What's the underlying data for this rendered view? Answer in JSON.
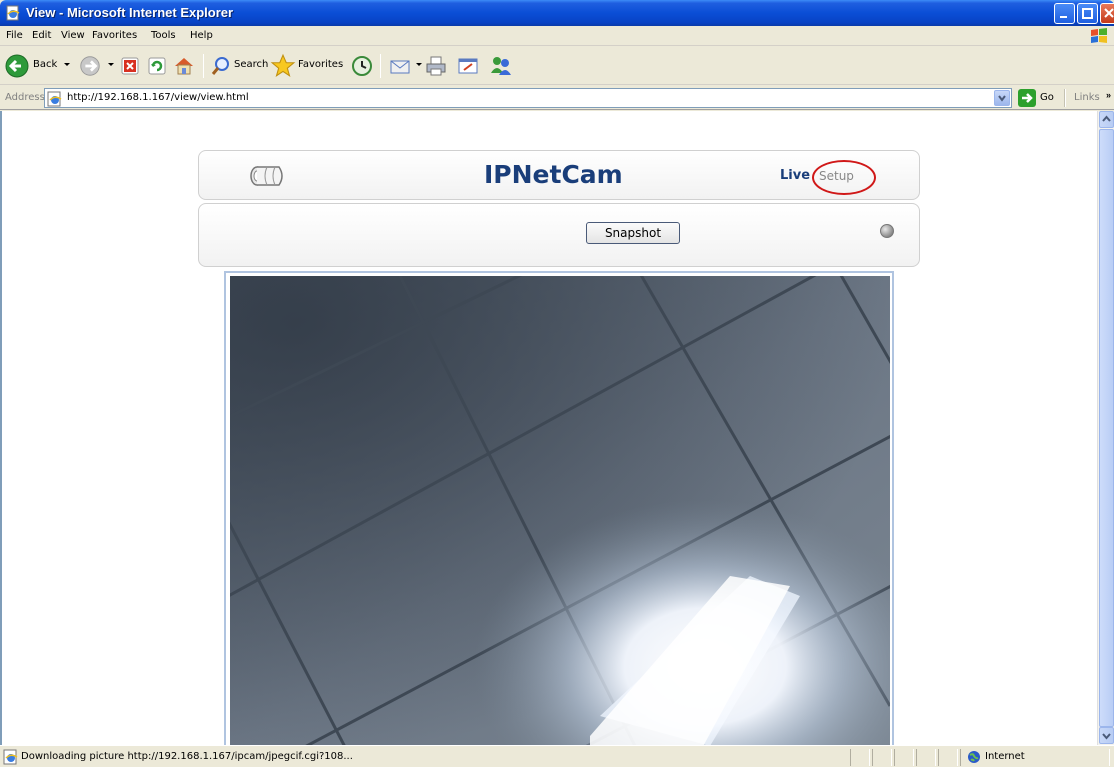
{
  "window": {
    "title": "View - Microsoft Internet Explorer"
  },
  "menu": {
    "items": [
      "File",
      "Edit",
      "View",
      "Favorites",
      "Tools",
      "Help"
    ]
  },
  "toolbar": {
    "back_label": "Back",
    "search_label": "Search",
    "favorites_label": "Favorites"
  },
  "address": {
    "label": "Address",
    "url": "http://192.168.1.167/view/view.html",
    "go_label": "Go",
    "links_label": "Links"
  },
  "page": {
    "brand": "IPNetCam",
    "nav_live": "Live",
    "nav_setup": "Setup",
    "snapshot_label": "Snapshot"
  },
  "status": {
    "text": "Downloading picture http://192.168.1.167/ipcam/jpegcif.cgi?108...",
    "zone": "Internet"
  }
}
